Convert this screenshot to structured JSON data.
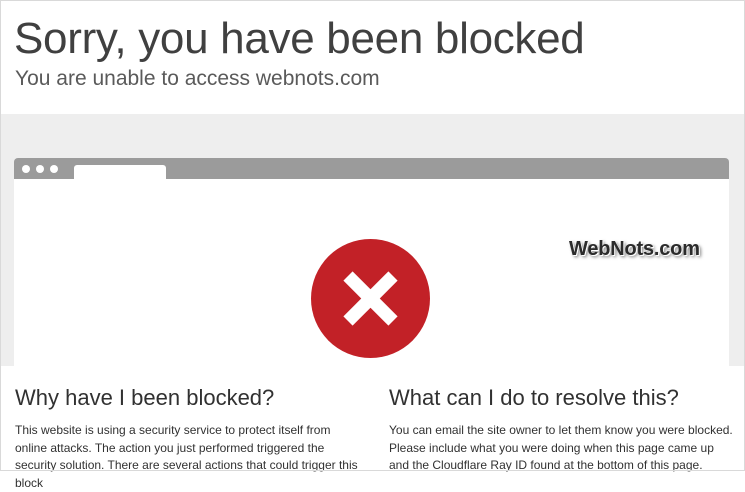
{
  "header": {
    "title": "Sorry, you have been blocked",
    "subtitle": "You are unable to access webnots.com"
  },
  "illustration": {
    "browser_dots": 3,
    "error_icon": "x-mark-icon",
    "error_color": "#c22127",
    "watermark": "WebNots.com"
  },
  "sections": {
    "why": {
      "heading": "Why have I been blocked?",
      "body": "This website is using a security service to protect itself from online attacks. The action you just performed triggered the security solution. There are several actions that could trigger this block"
    },
    "resolve": {
      "heading": "What can I do to resolve this?",
      "body": "You can email the site owner to let them know you were blocked. Please include what you were doing when this page came up and the Cloudflare Ray ID found at the bottom of this page."
    }
  }
}
